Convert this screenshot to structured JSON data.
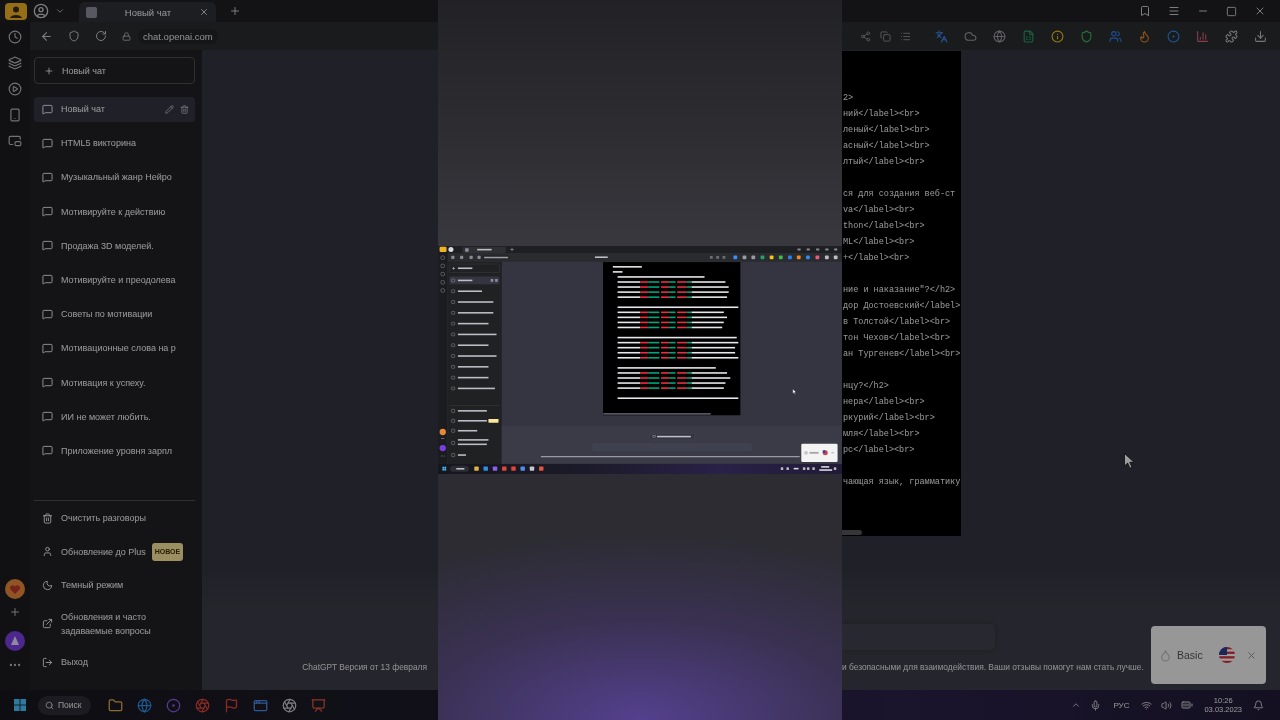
{
  "backdrop": {
    "left": {
      "tab": {
        "title": "Новый чат"
      },
      "address": "chat.openai.com",
      "sidebar": {
        "new_chat": "Новый чат",
        "chats": [
          {
            "title": "Новый чат",
            "selected": true
          },
          {
            "title": "HTML5 викторина",
            "selected": false
          },
          {
            "title": "Музыкальный жанр Нейро",
            "selected": false
          },
          {
            "title": "Мотивируйте к действию",
            "selected": false
          },
          {
            "title": "Продажа 3D моделей.",
            "selected": false
          },
          {
            "title": "Мотивируйте и преодолева",
            "selected": false
          },
          {
            "title": "Советы по мотивации",
            "selected": false
          },
          {
            "title": "Мотивационные слова на р",
            "selected": false
          },
          {
            "title": "Мотивация к успеху.",
            "selected": false
          },
          {
            "title": "ИИ не может любить.",
            "selected": false
          },
          {
            "title": "Приложение уровня зарпл",
            "selected": false
          }
        ],
        "menu": [
          {
            "kind": "clear",
            "label": "Очистить разговоры"
          },
          {
            "kind": "upgrade",
            "label": "Обновление до Plus",
            "badge": "НОВОЕ"
          },
          {
            "kind": "theme",
            "label": "Темный режим"
          },
          {
            "kind": "help",
            "label": "Обновления и часто задаваемые вопросы"
          },
          {
            "kind": "logout",
            "label": "Выход"
          }
        ]
      },
      "footer_fragment": "ChatGPT Версия от 13 февраля",
      "taskbar": {
        "search": "Поиск"
      }
    },
    "right": {
      "code_fragments": [
        {
          "lines": [
            "2>",
            "ний</label><br>",
            "леный</label><br>",
            "асный</label><br>",
            "лтый</label><br>"
          ]
        },
        {
          "lines": [
            "ся для создания веб-ст",
            "va</label><br>",
            "thon</label><br>",
            "ML</label><br>",
            "+</label><br>"
          ]
        },
        {
          "lines": [
            "ние и наказание\"?</h2>",
            "дор Достоевский</label>",
            "в Толстой</label><br>",
            "тон Чехов</label><br>",
            "ан Тургенев</label><br>"
          ]
        },
        {
          "lines": [
            "нцу?</h2>",
            "нера</label><br>",
            "ркурий</label><br>",
            "мля</label><br>",
            "рс</label><br>"
          ]
        },
        {
          "lines": [
            "чающая язык, грамматику"
          ]
        }
      ],
      "footer_fragment": "и безопасными для взаимодействия. Ваши отзывы помогут нам стать лучше.",
      "popup": {
        "label": "Basic"
      },
      "tray": {
        "language": "РУС",
        "time": "10:26",
        "date": "03.03.2023"
      }
    }
  }
}
